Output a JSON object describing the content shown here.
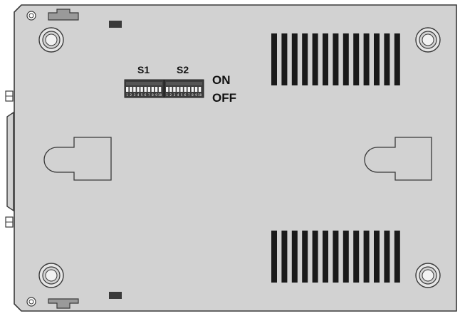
{
  "labels": {
    "switch_1": "S1",
    "switch_2": "S2",
    "on": "ON",
    "off": "OFF"
  },
  "dip_switches": [
    {
      "name": "S1",
      "positions": [
        "1",
        "2",
        "3",
        "4",
        "5",
        "6",
        "7",
        "8",
        "9",
        "10"
      ]
    },
    {
      "name": "S2",
      "positions": [
        "1",
        "2",
        "3",
        "4",
        "5",
        "6",
        "7",
        "8",
        "9",
        "10"
      ]
    }
  ],
  "colors": {
    "panel": "#d2d2d2",
    "outline": "#3a3a3a",
    "vent_slot": "#1a1a1a",
    "dip_body": "#3c3c3c"
  },
  "vent_slots_per_grille": 13
}
